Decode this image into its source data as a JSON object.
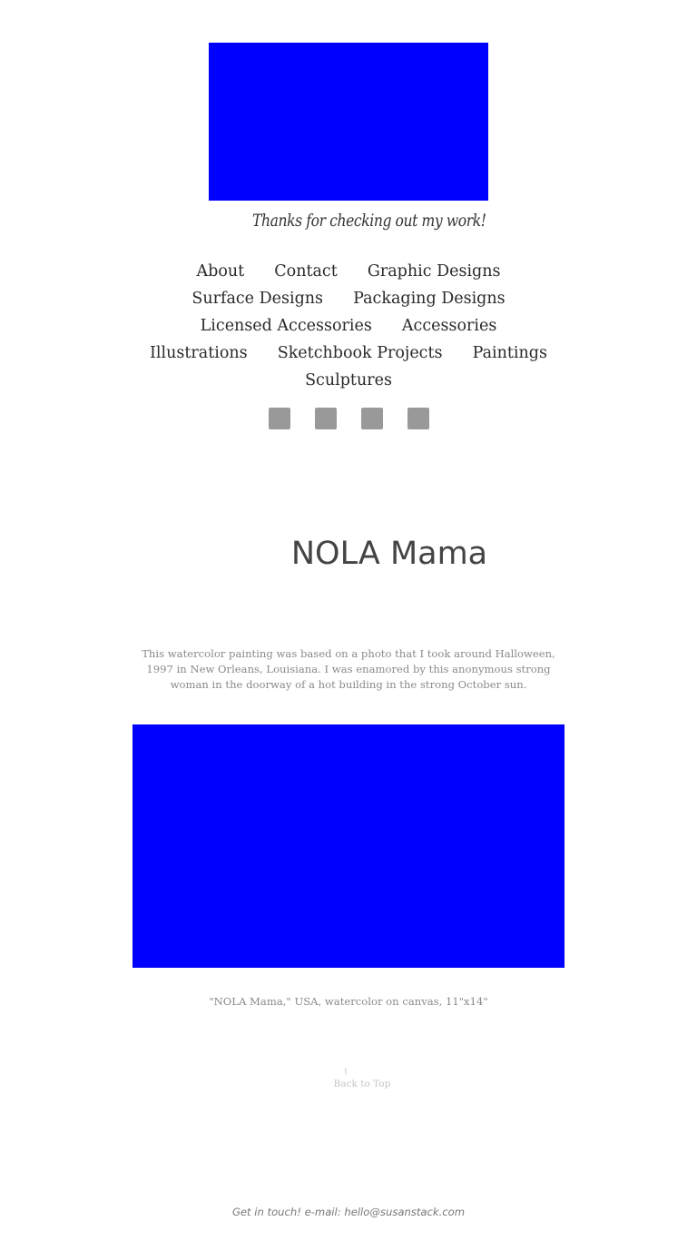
{
  "header": {
    "tagline": "Thanks for checking out my work!"
  },
  "nav": {
    "rows": [
      [
        "About",
        "Contact",
        "Graphic Designs"
      ],
      [
        "Surface Designs",
        "Packaging Designs"
      ],
      [
        "Licensed Accessories",
        "Accessories"
      ],
      [
        "Illustrations",
        "Sketchbook Projects",
        "Paintings"
      ],
      [
        "Sculptures"
      ]
    ]
  },
  "social": {
    "icons": [
      "social-icon",
      "social-icon",
      "social-icon",
      "social-icon"
    ],
    "icon_color": "#999999"
  },
  "post": {
    "title": "NOLA Mama",
    "description": "This watercolor painting was based on a photo that I took around Halloween, 1997 in New Orleans, Louisiana. I was enamored by this anonymous strong woman in the doorway of a hot building in the strong October sun.",
    "caption": "\"NOLA Mama,\" USA, watercolor on canvas, 11\"x14\""
  },
  "back_to_top": {
    "arrow": "↑",
    "label": "Back to Top"
  },
  "footer": {
    "prefix": "Get in touch! e-mail: ",
    "email": "hello@susanstack.com"
  },
  "colors": {
    "image_placeholder": "#0000ff",
    "text_muted": "#8a8a8a"
  }
}
